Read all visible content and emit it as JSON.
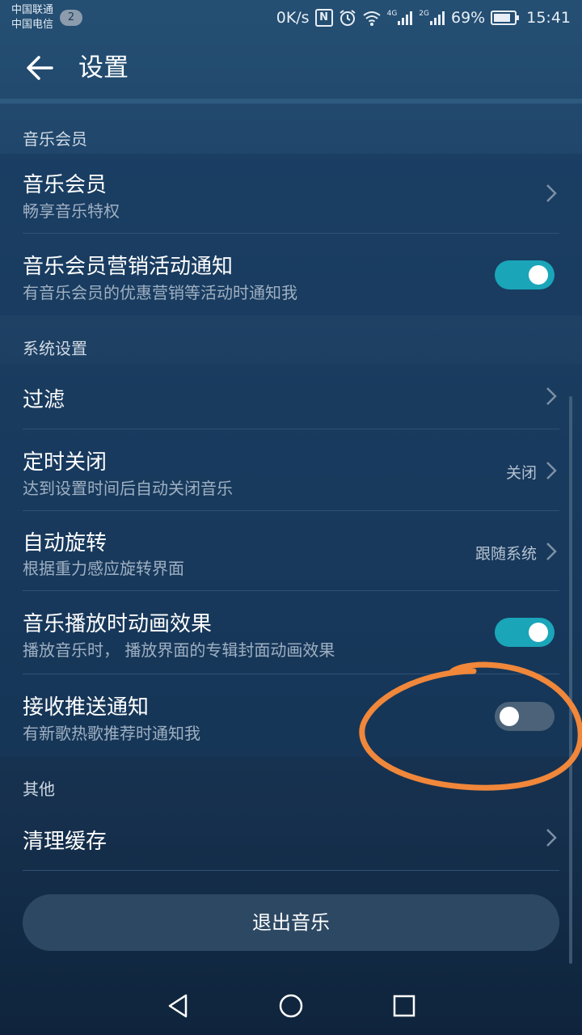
{
  "status_bar": {
    "carrier_1": "中国联通",
    "carrier_2": "中国电信",
    "sim_badge": "2",
    "net_speed": "0K/s",
    "nfc": "N",
    "signal_1_type": "4G",
    "signal_2_type": "2G",
    "battery": "69%",
    "time": "15:41"
  },
  "app_bar": {
    "title": "设置",
    "back_icon": "arrow-left-icon"
  },
  "sections": {
    "music_member": {
      "header": "音乐会员",
      "member": {
        "title": "音乐会员",
        "subtitle": "畅享音乐特权"
      },
      "marketing": {
        "title": "音乐会员营销活动通知",
        "subtitle": "有音乐会员的优惠营销等活动时通知我",
        "enabled": true
      }
    },
    "system": {
      "header": "系统设置",
      "filter": {
        "title": "过滤"
      },
      "sleep_timer": {
        "title": "定时关闭",
        "subtitle": "达到设置时间后自动关闭音乐",
        "value": "关闭"
      },
      "auto_rotate": {
        "title": "自动旋转",
        "subtitle": "根据重力感应旋转界面",
        "value": "跟随系统"
      },
      "animation": {
        "title": "音乐播放时动画效果",
        "subtitle": "播放音乐时， 播放界面的专辑封面动画效果",
        "enabled": true
      },
      "push": {
        "title": "接收推送通知",
        "subtitle": "有新歌热歌推荐时通知我",
        "enabled": false
      }
    },
    "other": {
      "header": "其他",
      "clear_cache": {
        "title": "清理缓存"
      }
    }
  },
  "exit_button": "退出音乐",
  "colors": {
    "toggle_on": "#1aa5b9",
    "toggle_off": "#4b6278",
    "annotation": "#f0873a"
  },
  "nav_bar": {
    "icons": [
      "back-triangle-icon",
      "home-circle-icon",
      "recents-square-icon"
    ]
  }
}
